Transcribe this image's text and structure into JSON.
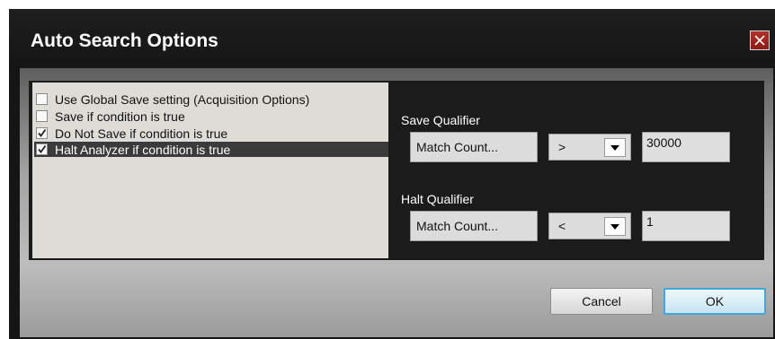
{
  "dialog": {
    "title": "Auto Search Options",
    "close_icon": "close-x-icon"
  },
  "options": [
    {
      "label": "Use Global Save setting (Acquisition Options)",
      "checked": false,
      "selected": false
    },
    {
      "label": "Save if condition is true",
      "checked": false,
      "selected": false
    },
    {
      "label": "Do Not Save if condition is true",
      "checked": true,
      "selected": false
    },
    {
      "label": "Halt Analyzer if condition is true",
      "checked": true,
      "selected": true
    }
  ],
  "save_qualifier": {
    "label": "Save Qualifier",
    "field": "Match Count...",
    "operator": ">",
    "value": "30000"
  },
  "halt_qualifier": {
    "label": "Halt Qualifier",
    "field": "Match Count...",
    "operator": "<",
    "value": "1"
  },
  "buttons": {
    "cancel": "Cancel",
    "ok": "OK"
  },
  "colors": {
    "title_bar": "#1e1e1e",
    "ok_border": "#3fa7dc",
    "close_button": "#b3302a"
  }
}
